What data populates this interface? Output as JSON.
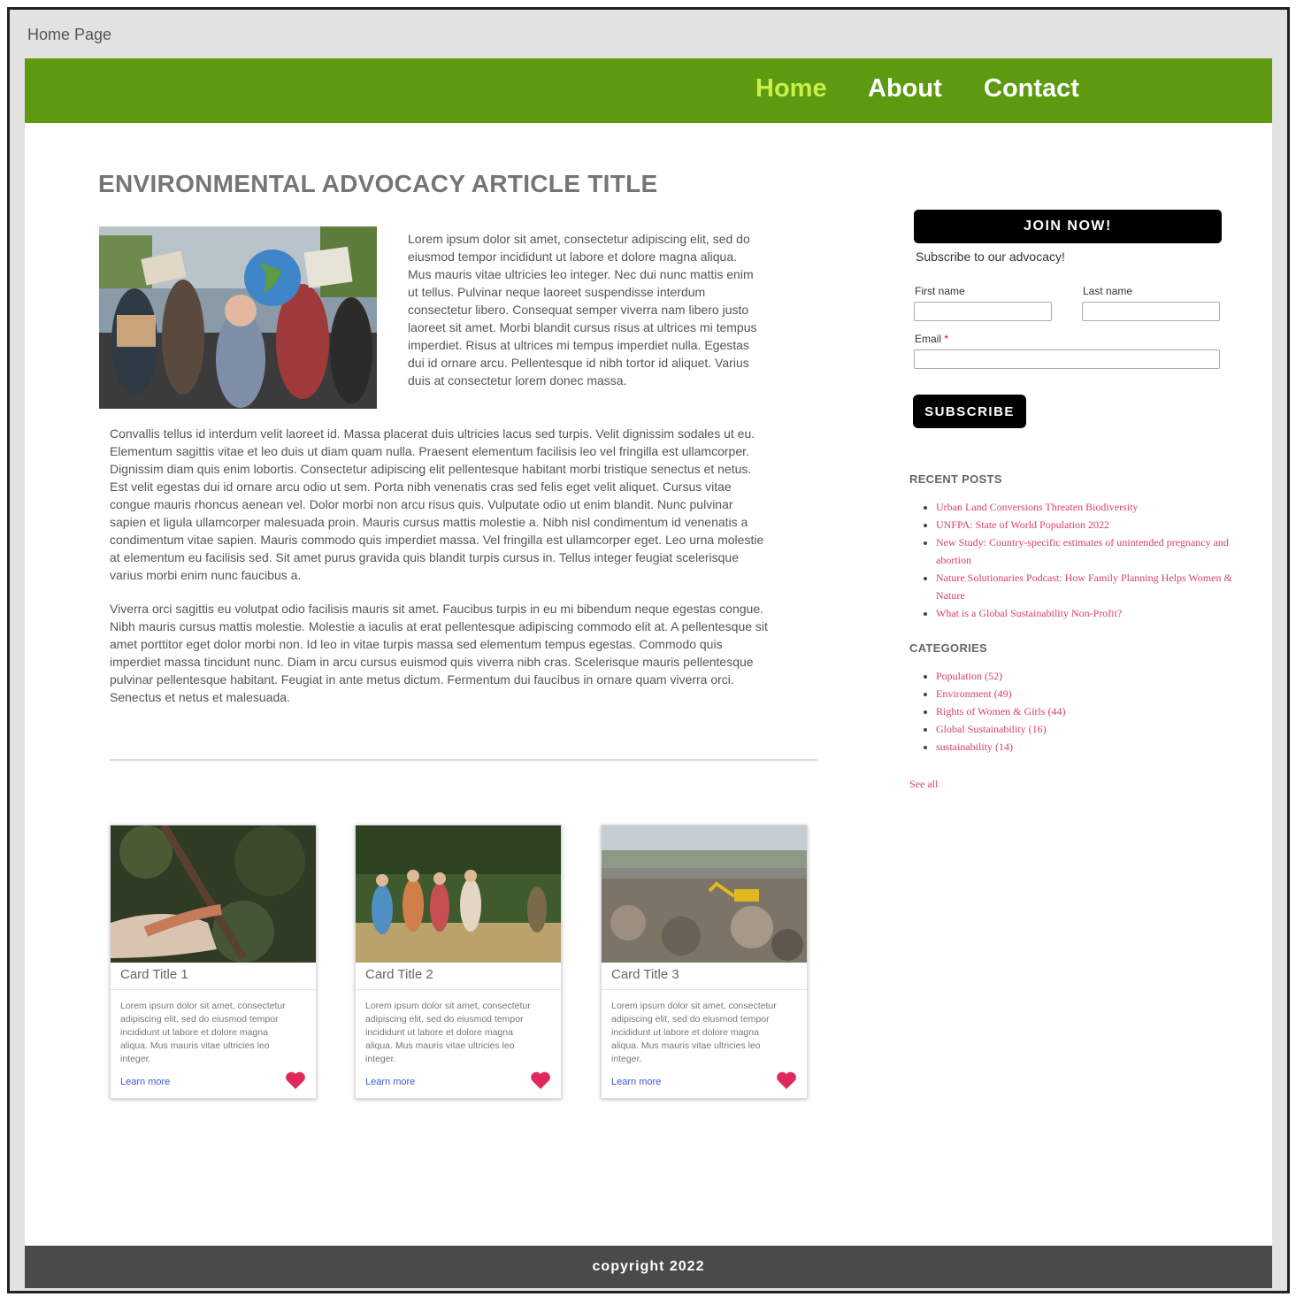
{
  "tab": {
    "label": "Home Page"
  },
  "nav": {
    "items": [
      {
        "label": "Home",
        "active": true
      },
      {
        "label": "About",
        "active": false
      },
      {
        "label": "Contact",
        "active": false
      }
    ]
  },
  "article": {
    "title": "ENVIRONMENTAL ADVOCACY ARTICLE TITLE",
    "intro": "Lorem ipsum dolor sit amet, consectetur adipiscing elit, sed do eiusmod tempor incididunt ut labore et dolore magna aliqua. Mus mauris vitae ultricies leo integer. Nec dui nunc mattis enim ut tellus. Pulvinar neque laoreet suspendisse interdum consectetur libero. Consequat semper viverra nam libero justo laoreet sit amet. Morbi blandit cursus risus at ultrices mi tempus imperdiet. Risus at ultrices mi tempus imperdiet nulla. Egestas dui id ornare arcu. Pellentesque id nibh tortor id aliquet. Varius duis at consectetur lorem donec massa.",
    "paragraph1": "Convallis tellus id interdum velit laoreet id. Massa placerat duis ultricies lacus sed turpis. Velit dignissim sodales ut eu. Elementum sagittis vitae et leo duis ut diam quam nulla. Praesent elementum facilisis leo vel fringilla est ullamcorper. Dignissim diam quis enim lobortis. Consectetur adipiscing elit pellentesque habitant morbi tristique senectus et netus. Est velit egestas dui id ornare arcu odio ut sem. Porta nibh venenatis cras sed felis eget velit aliquet. Cursus vitae congue mauris rhoncus aenean vel. Dolor morbi non arcu risus quis. Vulputate odio ut enim blandit. Nunc pulvinar sapien et ligula ullamcorper malesuada proin. Mauris cursus mattis molestie a. Nibh nisl condimentum id venenatis a condimentum vitae sapien. Mauris commodo quis imperdiet massa. Vel fringilla est ullamcorper eget. Leo urna molestie at elementum eu facilisis sed. Sit amet purus gravida quis blandit turpis cursus in. Tellus integer feugiat scelerisque varius morbi enim nunc faucibus a.",
    "paragraph2": "Viverra orci sagittis eu volutpat odio facilisis mauris sit amet. Faucibus turpis in eu mi bibendum neque egestas congue. Nibh mauris cursus mattis molestie. Molestie a iaculis at erat pellentesque adipiscing commodo elit at. A pellentesque sit amet porttitor eget dolor morbi non. Id leo in vitae turpis massa sed elementum tempus egestas. Commodo quis imperdiet massa tincidunt nunc. Diam in arcu cursus euismod quis viverra nibh cras. Scelerisque mauris pellentesque pulvinar pellentesque habitant. Feugiat in ante metus dictum. Fermentum dui faucibus in ornare quam viverra orci. Senectus et netus et malesuada."
  },
  "cards": [
    {
      "title": "Card Title 1",
      "text": "Lorem ipsum dolor sit amet, consectetur adipiscing elit, sed do eiusmod tempor incididunt ut labore et dolore magna aliqua. Mus mauris vitae ultricies leo integer.",
      "link": "Learn more"
    },
    {
      "title": "Card Title 2",
      "text": "Lorem ipsum dolor sit amet, consectetur adipiscing elit, sed do eiusmod tempor incididunt ut labore et dolore magna aliqua. Mus mauris vitae ultricies leo integer.",
      "link": "Learn more"
    },
    {
      "title": "Card Title 3",
      "text": "Lorem ipsum dolor sit amet, consectetur adipiscing elit, sed do eiusmod tempor incididunt ut labore et dolore magna aliqua. Mus mauris vitae ultricies leo integer.",
      "link": "Learn more"
    }
  ],
  "signup": {
    "join_label": "JOIN NOW!",
    "subtitle": "Subscribe to our advocacy!",
    "first_name_label": "First name",
    "last_name_label": "Last name",
    "email_label": "Email",
    "required_mark": "*",
    "subscribe_label": "SUBSCRIBE"
  },
  "sidebar": {
    "recent_heading": "RECENT POSTS",
    "recent_posts": [
      "Urban Land Conversions Threaten Biodiversity",
      "UNFPA: State of World Population 2022",
      "New Study: Country-specific estimates of unintended pregnancy and abortion",
      "Nature Solutionaries Podcast: How Family Planning Helps Women & Nature",
      "What is a Global Sustainability Non-Profit?"
    ],
    "categories_heading": "CATEGORIES",
    "categories": [
      "Population (52)",
      "Environment (49)",
      "Rights of Women & Girls (44)",
      "Global Sustainability (16)",
      "sustainability (14)"
    ],
    "see_all": "See all"
  },
  "footer": {
    "text": "copyright 2022"
  },
  "colors": {
    "nav": "#5e9a10",
    "nav_active": "#c8ef4a",
    "link_pink": "#d9406a",
    "footer": "#4a4a4a"
  },
  "icons": {
    "heart": "heart-icon"
  }
}
